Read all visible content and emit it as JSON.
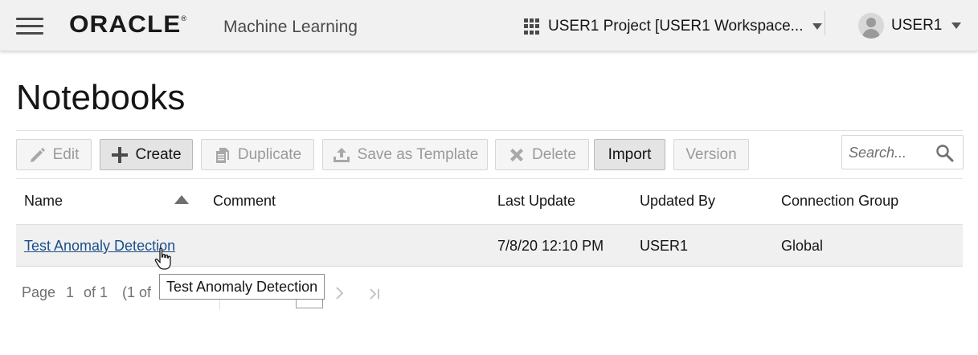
{
  "header": {
    "brand": "ORACLE",
    "brand_mark": "®",
    "product": "Machine Learning",
    "project_label": "USER1 Project [USER1 Workspace...",
    "user_label": "USER1"
  },
  "page": {
    "title": "Notebooks"
  },
  "toolbar": {
    "edit": "Edit",
    "create": "Create",
    "duplicate": "Duplicate",
    "save_template": "Save as Template",
    "delete": "Delete",
    "import": "Import",
    "version": "Version"
  },
  "search": {
    "placeholder": "Search..."
  },
  "table": {
    "columns": [
      "Name",
      "Comment",
      "Last Update",
      "Updated By",
      "Connection Group"
    ],
    "rows": [
      {
        "name": "Test Anomaly Detection",
        "comment": "",
        "last_update": "7/8/20 12:10 PM",
        "updated_by": "USER1",
        "connection_group": "Global"
      }
    ]
  },
  "pager": {
    "page_label": "Page",
    "page_num": "1",
    "page_of": "of 1",
    "range_partial": "(1 of"
  },
  "tooltip": {
    "text": "Test Anomaly Detection"
  },
  "colors": {
    "link": "#1a4f8b",
    "header_bg": "#f1f1f1",
    "enabled_button_bg": "#e4e4e4"
  },
  "icons": [
    "hamburger-icon",
    "grid-icon",
    "chevron-down-icon",
    "avatar-icon",
    "pencil-icon",
    "plus-icon",
    "duplicate-icon",
    "upload-icon",
    "close-icon",
    "search-icon",
    "sort-ascending-icon",
    "next-page-icon",
    "last-page-icon",
    "hand-cursor-icon"
  ]
}
